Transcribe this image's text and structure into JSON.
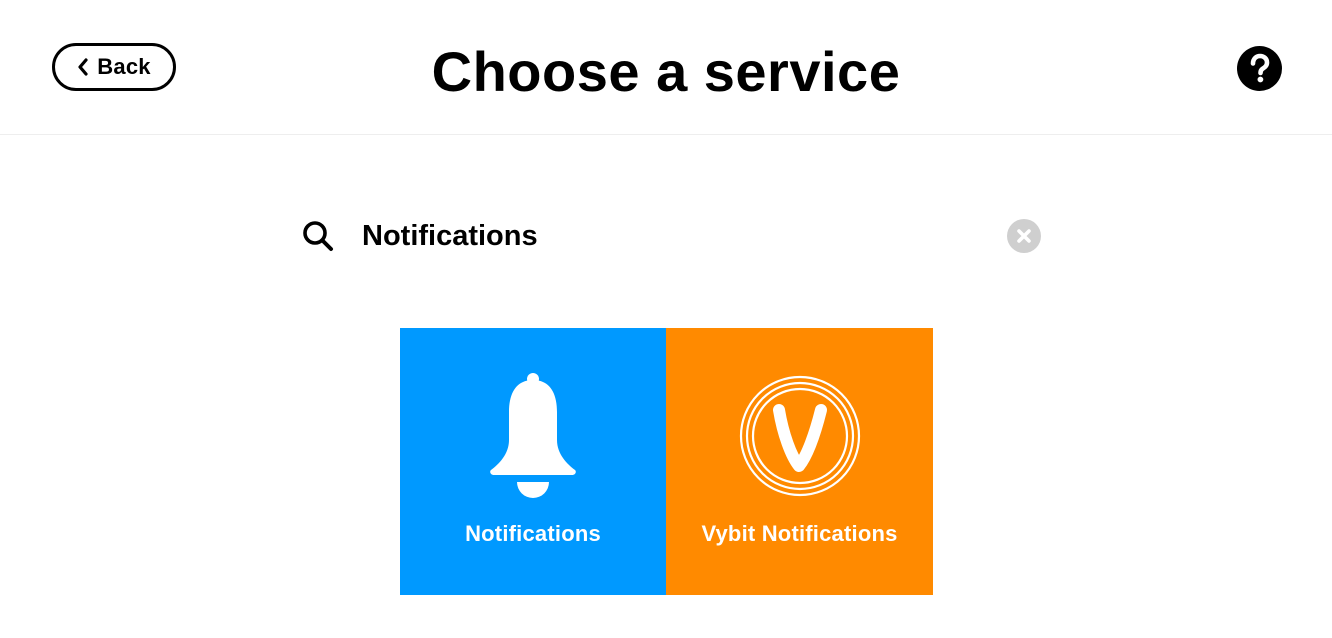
{
  "header": {
    "back_label": "Back",
    "back_icon": "chevron-left-icon",
    "title": "Choose a service",
    "help_icon": "question-mark-icon"
  },
  "search": {
    "value": "Notifications",
    "icon": "search-icon",
    "clear_icon": "clear-icon"
  },
  "services": [
    {
      "label": "Notifications",
      "icon": "bell-icon",
      "color": "#0099ff"
    },
    {
      "label": "Vybit Notifications",
      "icon": "vybit-logo-icon",
      "color": "#ff8a00"
    }
  ]
}
